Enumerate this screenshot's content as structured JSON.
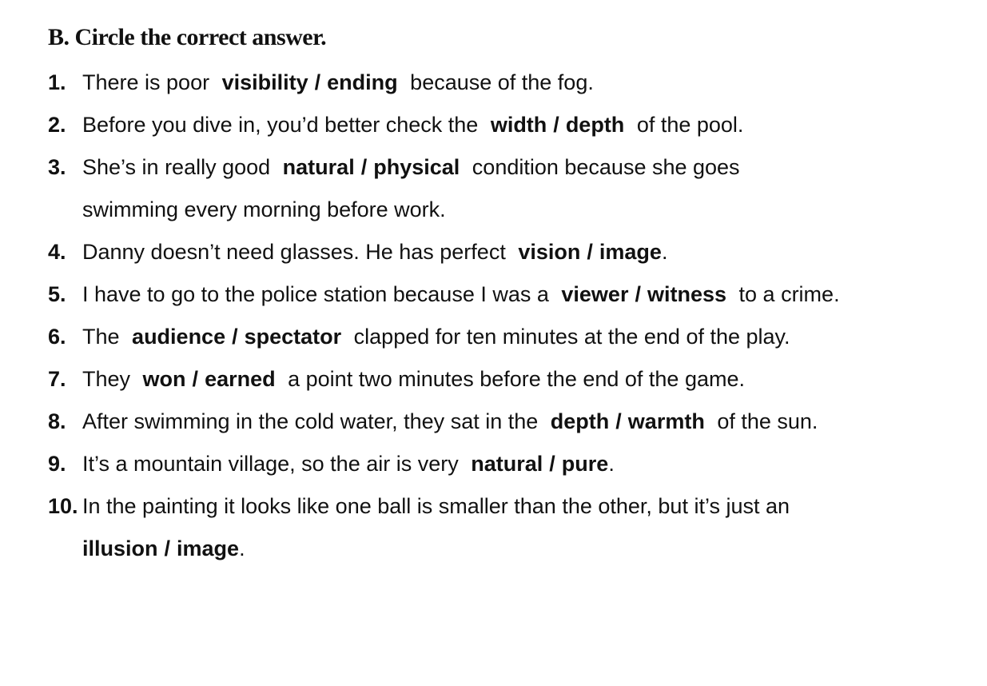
{
  "title": "B. Circle the correct answer.",
  "items": [
    {
      "num": "1.",
      "before": "There is poor",
      "opt1": "visibility",
      "sep": "/",
      "opt2": "ending",
      "after": "because of the fog."
    },
    {
      "num": "2.",
      "before": "Before you dive in, you’d better check the",
      "opt1": "width",
      "sep": "/",
      "opt2": "depth",
      "after": "of the pool."
    },
    {
      "num": "3.",
      "before": "She’s in really good",
      "opt1": "natural",
      "sep": "/",
      "opt2": "physical",
      "after": "condition because she goes swimming every morning before work."
    },
    {
      "num": "4.",
      "before": "Danny doesn’t need glasses. He has perfect",
      "opt1": "vision",
      "sep": "/",
      "opt2": "image",
      "after": "."
    },
    {
      "num": "5.",
      "before": "I have to go to the police station because I was a",
      "opt1": "viewer",
      "sep": "/",
      "opt2": "witness",
      "after": "to a crime."
    },
    {
      "num": "6.",
      "before": "The",
      "opt1": "audience",
      "sep": "/",
      "opt2": "spectator",
      "after": "clapped for ten minutes at the end of the play."
    },
    {
      "num": "7.",
      "before": "They",
      "opt1": "won",
      "sep": "/",
      "opt2": "earned",
      "after": "a point two minutes before the end of the game."
    },
    {
      "num": "8.",
      "before": "After swimming in the cold water, they sat in the",
      "opt1": "depth",
      "sep": "/",
      "opt2": "warmth",
      "after": "of the sun."
    },
    {
      "num": "9.",
      "before": "It’s a mountain village, so the air is very",
      "opt1": "natural",
      "sep": "/",
      "opt2": "pure",
      "after": "."
    },
    {
      "num": "10.",
      "before": "In the painting it looks like one ball is smaller than the other, but it’s just an",
      "opt1": "illusion",
      "sep": "/",
      "opt2": "image",
      "after": "."
    }
  ]
}
